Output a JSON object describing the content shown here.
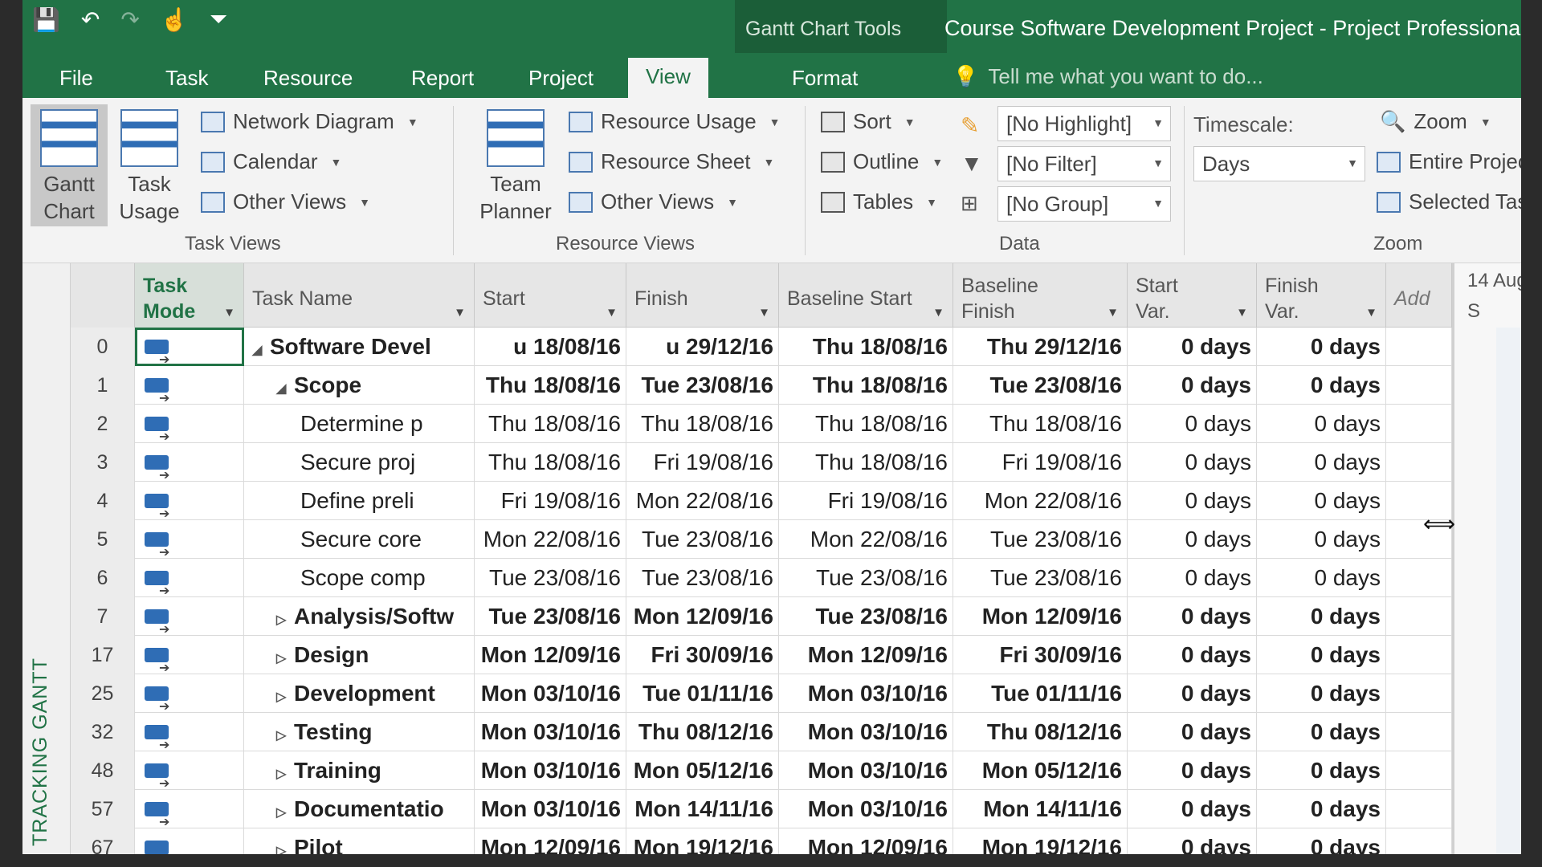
{
  "quick_access": {
    "save": "💾",
    "undo": "↶",
    "redo": "↷",
    "touch": "☝",
    "customize": "⏷"
  },
  "contextual_group": "Gantt Chart Tools",
  "document_title": "Course Software Development Project - Project Professional",
  "tabs": [
    "File",
    "Task",
    "Resource",
    "Report",
    "Project",
    "View",
    "Format"
  ],
  "active_tab": "View",
  "tell_me": "Tell me what you want to do...",
  "ribbon": {
    "task_views": {
      "label": "Task Views",
      "gantt_chart": "Gantt Chart",
      "task_usage": "Task Usage",
      "network_diagram": "Network Diagram",
      "calendar": "Calendar",
      "other_views": "Other Views"
    },
    "resource_views": {
      "label": "Resource Views",
      "team_planner": "Team Planner",
      "resource_usage": "Resource Usage",
      "resource_sheet": "Resource Sheet",
      "other_views": "Other Views"
    },
    "data": {
      "label": "Data",
      "sort": "Sort",
      "outline": "Outline",
      "tables": "Tables",
      "highlight": "[No Highlight]",
      "filter": "[No Filter]",
      "group": "[No Group]"
    },
    "zoom": {
      "label": "Zoom",
      "timescale_label": "Timescale:",
      "timescale_value": "Days",
      "zoom": "Zoom",
      "entire_project": "Entire Project",
      "selected_tasks": "Selected Tasks"
    }
  },
  "view_bar": "TRACKING GANTT",
  "columns": {
    "task_mode": "Task Mode",
    "task_name": "Task Name",
    "start": "Start",
    "finish": "Finish",
    "baseline_start": "Baseline Start",
    "baseline_finish": "Baseline Finish",
    "start_var": "Start Var.",
    "finish_var": "Finish Var.",
    "add": "Add"
  },
  "timescale": {
    "week": "14 Aug",
    "days": "S M"
  },
  "rows": [
    {
      "id": "0",
      "name": "Software Devel",
      "start": "u 18/08/16",
      "finish": "u 29/12/16",
      "bstart": "Thu 18/08/16",
      "bfinish": "Thu 29/12/16",
      "svar": "0 days",
      "fvar": "0 days"
    },
    {
      "id": "1",
      "name": "Scope",
      "start": "Thu 18/08/16",
      "finish": "Tue 23/08/16",
      "bstart": "Thu 18/08/16",
      "bfinish": "Tue 23/08/16",
      "svar": "0 days",
      "fvar": "0 days"
    },
    {
      "id": "2",
      "name": "Determine p",
      "start": "Thu 18/08/16",
      "finish": "Thu 18/08/16",
      "bstart": "Thu 18/08/16",
      "bfinish": "Thu 18/08/16",
      "svar": "0 days",
      "fvar": "0 days"
    },
    {
      "id": "3",
      "name": "Secure proj",
      "start": "Thu 18/08/16",
      "finish": "Fri 19/08/16",
      "bstart": "Thu 18/08/16",
      "bfinish": "Fri 19/08/16",
      "svar": "0 days",
      "fvar": "0 days"
    },
    {
      "id": "4",
      "name": "Define preli",
      "start": "Fri 19/08/16",
      "finish": "Mon 22/08/16",
      "bstart": "Fri 19/08/16",
      "bfinish": "Mon 22/08/16",
      "svar": "0 days",
      "fvar": "0 days"
    },
    {
      "id": "5",
      "name": "Secure core",
      "start": "Mon 22/08/16",
      "finish": "Tue 23/08/16",
      "bstart": "Mon 22/08/16",
      "bfinish": "Tue 23/08/16",
      "svar": "0 days",
      "fvar": "0 days"
    },
    {
      "id": "6",
      "name": "Scope comp",
      "start": "Tue 23/08/16",
      "finish": "Tue 23/08/16",
      "bstart": "Tue 23/08/16",
      "bfinish": "Tue 23/08/16",
      "svar": "0 days",
      "fvar": "0 days"
    },
    {
      "id": "7",
      "name": "Analysis/Softw",
      "start": "Tue 23/08/16",
      "finish": "Mon 12/09/16",
      "bstart": "Tue 23/08/16",
      "bfinish": "Mon 12/09/16",
      "svar": "0 days",
      "fvar": "0 days"
    },
    {
      "id": "17",
      "name": "Design",
      "start": "Mon 12/09/16",
      "finish": "Fri 30/09/16",
      "bstart": "Mon 12/09/16",
      "bfinish": "Fri 30/09/16",
      "svar": "0 days",
      "fvar": "0 days"
    },
    {
      "id": "25",
      "name": "Development",
      "start": "Mon 03/10/16",
      "finish": "Tue 01/11/16",
      "bstart": "Mon 03/10/16",
      "bfinish": "Tue 01/11/16",
      "svar": "0 days",
      "fvar": "0 days"
    },
    {
      "id": "32",
      "name": "Testing",
      "start": "Mon 03/10/16",
      "finish": "Thu 08/12/16",
      "bstart": "Mon 03/10/16",
      "bfinish": "Thu 08/12/16",
      "svar": "0 days",
      "fvar": "0 days"
    },
    {
      "id": "48",
      "name": "Training",
      "start": "Mon 03/10/16",
      "finish": "Mon 05/12/16",
      "bstart": "Mon 03/10/16",
      "bfinish": "Mon 05/12/16",
      "svar": "0 days",
      "fvar": "0 days"
    },
    {
      "id": "57",
      "name": "Documentatio",
      "start": "Mon 03/10/16",
      "finish": "Mon 14/11/16",
      "bstart": "Mon 03/10/16",
      "bfinish": "Mon 14/11/16",
      "svar": "0 days",
      "fvar": "0 days"
    },
    {
      "id": "67",
      "name": "Pilot",
      "start": "Mon 12/09/16",
      "finish": "Mon 19/12/16",
      "bstart": "Mon 12/09/16",
      "bfinish": "Mon 19/12/16",
      "svar": "0 days",
      "fvar": "0 days"
    }
  ],
  "colors": {
    "accent": "#217346",
    "accent_dark": "#1b5e38",
    "mode_icon": "#2f6db5"
  }
}
